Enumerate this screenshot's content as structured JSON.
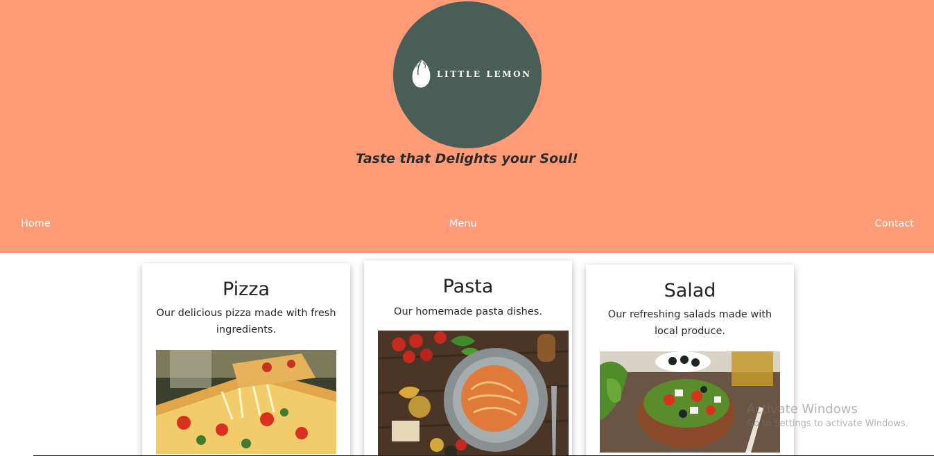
{
  "header": {
    "logo_text": "LITTLE LEMON",
    "tagline": "Taste that Delights your Soul!",
    "background": "#ff9c77",
    "logo_background": "#495e57"
  },
  "nav": {
    "home": "Home",
    "menu": "Menu",
    "contact": "Contact"
  },
  "cards": [
    {
      "title": "Pizza",
      "description": "Our delicious pizza made with fresh ingredients.",
      "image_alt": "pizza-photo"
    },
    {
      "title": "Pasta",
      "description": "Our homemade pasta dishes.",
      "image_alt": "pasta-photo"
    },
    {
      "title": "Salad",
      "description": "Our refreshing salads made with local produce.",
      "image_alt": "salad-photo"
    }
  ],
  "watermark": {
    "title": "Activate Windows",
    "subtitle": "Go to Settings to activate Windows."
  }
}
